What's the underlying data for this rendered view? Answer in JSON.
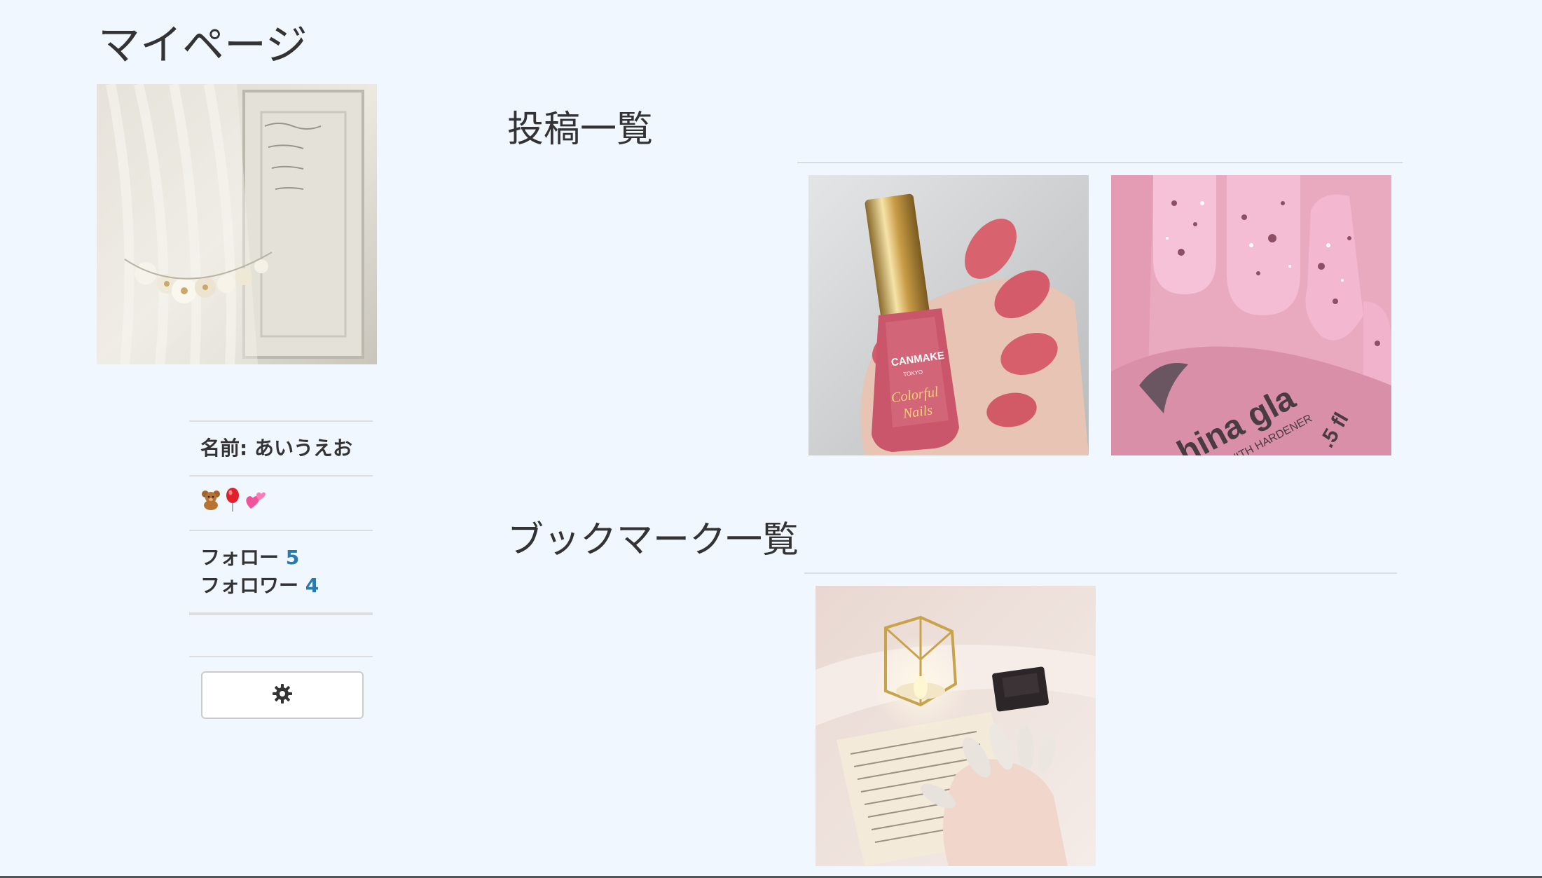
{
  "page": {
    "title": "マイページ"
  },
  "profile": {
    "name_label": "名前: あいうえお",
    "emoji_icons": [
      "teddy-bear-icon",
      "balloon-icon",
      "two-hearts-icon"
    ],
    "follow_label": "フォロー",
    "follow_count": "5",
    "follower_label": "フォロワー",
    "follower_count": "4",
    "settings_icon": "gear-icon"
  },
  "posts": {
    "heading": "投稿一覧",
    "items": [
      {
        "alt": "pink nail polish bottle with pink manicure"
      },
      {
        "alt": "pink nails with glitter polish"
      }
    ]
  },
  "bookmarks": {
    "heading": "ブックマーク一覧",
    "items": [
      {
        "alt": "nude nails with candle and book"
      }
    ]
  },
  "colors": {
    "background": "#f0f7ff",
    "link_count": "#2a7ab0",
    "divider": "#dddddd"
  }
}
